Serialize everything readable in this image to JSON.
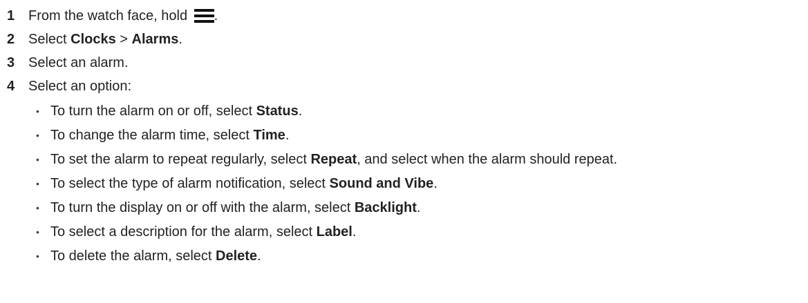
{
  "icons": {
    "menu": "menu-icon"
  },
  "heading_fragment": "",
  "steps": [
    {
      "num": "1",
      "pre": "From the watch face, hold ",
      "icon": "menu-icon",
      "post": "."
    },
    {
      "num": "2",
      "pre": "Select ",
      "b1": "Clocks",
      "mid": " > ",
      "b2": "Alarms",
      "post": "."
    },
    {
      "num": "3",
      "text": "Select an alarm."
    },
    {
      "num": "4",
      "text": "Select an option:"
    }
  ],
  "options": [
    {
      "pre": "To turn the alarm on or off, select ",
      "bold": "Status",
      "post": "."
    },
    {
      "pre": "To change the alarm time, select ",
      "bold": "Time",
      "post": "."
    },
    {
      "pre": "To set the alarm to repeat regularly, select ",
      "bold": "Repeat",
      "post": ", and select when the alarm should repeat."
    },
    {
      "pre": "To select the type of alarm notification, select ",
      "bold": "Sound and Vibe",
      "post": "."
    },
    {
      "pre": "To turn the display on or off with the alarm, select ",
      "bold": "Backlight",
      "post": "."
    },
    {
      "pre": "To select a description for the alarm, select ",
      "bold": "Label",
      "post": "."
    },
    {
      "pre": "To delete the alarm, select ",
      "bold": "Delete",
      "post": "."
    }
  ],
  "bullet_char": "•"
}
